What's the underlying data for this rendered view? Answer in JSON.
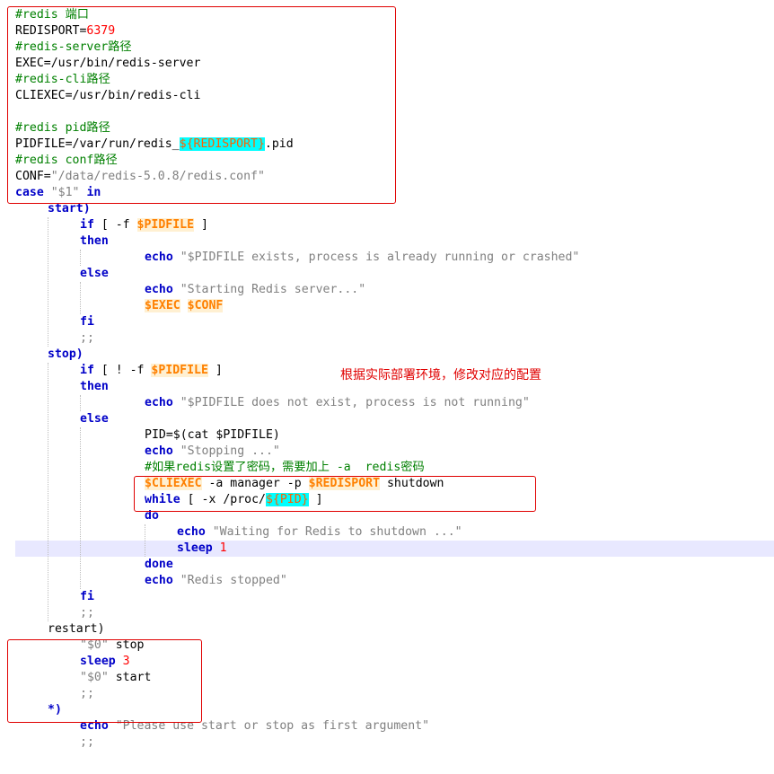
{
  "editor": {
    "annotation_note": "根据实际部署环境，修改对应的配置",
    "lines": [
      {
        "indent": 0,
        "tokens": [
          {
            "t": "#redis 端口",
            "c": "cm"
          }
        ]
      },
      {
        "indent": 0,
        "tokens": [
          {
            "t": "REDISPORT=",
            "c": "pl"
          },
          {
            "t": "6379",
            "c": "num"
          }
        ]
      },
      {
        "indent": 0,
        "tokens": [
          {
            "t": "#redis-server路径",
            "c": "cm"
          }
        ]
      },
      {
        "indent": 0,
        "tokens": [
          {
            "t": "EXEC=/usr/bin/redis-server",
            "c": "pl"
          }
        ]
      },
      {
        "indent": 0,
        "tokens": [
          {
            "t": "#redis-cli路径",
            "c": "cm"
          }
        ]
      },
      {
        "indent": 0,
        "tokens": [
          {
            "t": "CLIEXEC=/usr/bin/redis-cli",
            "c": "pl"
          }
        ]
      },
      {
        "indent": 0,
        "tokens": []
      },
      {
        "indent": 0,
        "tokens": [
          {
            "t": "#redis pid路径",
            "c": "cm"
          }
        ]
      },
      {
        "indent": 0,
        "tokens": [
          {
            "t": "PIDFILE=/var/run/redis_",
            "c": "pl"
          },
          {
            "t": "${REDISPORT}",
            "c": "cy"
          },
          {
            "t": ".pid",
            "c": "pl"
          }
        ]
      },
      {
        "indent": 0,
        "tokens": [
          {
            "t": "#redis conf路径",
            "c": "cm"
          }
        ]
      },
      {
        "indent": 0,
        "tokens": [
          {
            "t": "CONF=",
            "c": "pl"
          },
          {
            "t": "\"/data/redis-5.0.8/redis.conf\"",
            "c": "str"
          }
        ]
      },
      {
        "indent": 0,
        "tokens": [
          {
            "t": "case",
            "c": "kw"
          },
          {
            "t": " ",
            "c": "pl"
          },
          {
            "t": "\"$1\"",
            "c": "str"
          },
          {
            "t": " ",
            "c": "pl"
          },
          {
            "t": "in",
            "c": "kw"
          }
        ]
      },
      {
        "indent": 1,
        "tokens": [
          {
            "t": "start)",
            "c": "kw"
          }
        ]
      },
      {
        "indent": 2,
        "tokens": [
          {
            "t": "if",
            "c": "kw"
          },
          {
            "t": " [ -f ",
            "c": "pl"
          },
          {
            "t": "$PIDFILE",
            "c": "vr"
          },
          {
            "t": " ]",
            "c": "pl"
          }
        ]
      },
      {
        "indent": 2,
        "tokens": [
          {
            "t": "then",
            "c": "kw"
          }
        ]
      },
      {
        "indent": 4,
        "tokens": [
          {
            "t": "echo",
            "c": "kw"
          },
          {
            "t": " ",
            "c": "pl"
          },
          {
            "t": "\"$PIDFILE exists, process is already running or crashed\"",
            "c": "str"
          }
        ]
      },
      {
        "indent": 2,
        "tokens": [
          {
            "t": "else",
            "c": "kw"
          }
        ]
      },
      {
        "indent": 4,
        "tokens": [
          {
            "t": "echo",
            "c": "kw"
          },
          {
            "t": " ",
            "c": "pl"
          },
          {
            "t": "\"Starting Redis server...\"",
            "c": "str"
          }
        ]
      },
      {
        "indent": 4,
        "tokens": [
          {
            "t": "$EXEC",
            "c": "vr"
          },
          {
            "t": " ",
            "c": "pl"
          },
          {
            "t": "$CONF",
            "c": "vr"
          }
        ]
      },
      {
        "indent": 2,
        "tokens": [
          {
            "t": "fi",
            "c": "kw"
          }
        ]
      },
      {
        "indent": 2,
        "tokens": [
          {
            "t": ";;",
            "c": "str"
          }
        ]
      },
      {
        "indent": 1,
        "tokens": [
          {
            "t": "stop)",
            "c": "kw"
          }
        ]
      },
      {
        "indent": 2,
        "tokens": [
          {
            "t": "if",
            "c": "kw"
          },
          {
            "t": " [ ! -f ",
            "c": "pl"
          },
          {
            "t": "$PIDFILE",
            "c": "vr"
          },
          {
            "t": " ]",
            "c": "pl"
          }
        ]
      },
      {
        "indent": 2,
        "tokens": [
          {
            "t": "then",
            "c": "kw"
          }
        ]
      },
      {
        "indent": 4,
        "tokens": [
          {
            "t": "echo",
            "c": "kw"
          },
          {
            "t": " ",
            "c": "pl"
          },
          {
            "t": "\"$PIDFILE does not exist, process is not running\"",
            "c": "str"
          }
        ]
      },
      {
        "indent": 2,
        "tokens": [
          {
            "t": "else",
            "c": "kw"
          }
        ]
      },
      {
        "indent": 4,
        "tokens": [
          {
            "t": "PID=$(cat $PIDFILE)",
            "c": "pl"
          }
        ]
      },
      {
        "indent": 4,
        "tokens": [
          {
            "t": "echo",
            "c": "kw"
          },
          {
            "t": " ",
            "c": "pl"
          },
          {
            "t": "\"Stopping ...\"",
            "c": "str"
          }
        ]
      },
      {
        "indent": 4,
        "tokens": [
          {
            "t": "#如果redis设置了密码，需要加上 -a  redis密码",
            "c": "cm"
          }
        ]
      },
      {
        "indent": 4,
        "tokens": [
          {
            "t": "$CLIEXEC",
            "c": "vr"
          },
          {
            "t": " -a manager -p ",
            "c": "pl"
          },
          {
            "t": "$REDISPORT",
            "c": "vr"
          },
          {
            "t": " shutdown",
            "c": "pl"
          }
        ]
      },
      {
        "indent": 4,
        "tokens": [
          {
            "t": "while",
            "c": "kw"
          },
          {
            "t": " [ -x /proc/",
            "c": "pl"
          },
          {
            "t": "${PID}",
            "c": "cy"
          },
          {
            "t": " ]",
            "c": "pl"
          }
        ]
      },
      {
        "indent": 4,
        "tokens": [
          {
            "t": "do",
            "c": "kw"
          }
        ]
      },
      {
        "indent": 5,
        "tokens": [
          {
            "t": "echo",
            "c": "kw"
          },
          {
            "t": " ",
            "c": "pl"
          },
          {
            "t": "\"Waiting for Redis to shutdown ...\"",
            "c": "str"
          }
        ]
      },
      {
        "indent": 5,
        "tokens": [
          {
            "t": "sleep",
            "c": "kw"
          },
          {
            "t": " ",
            "c": "pl"
          },
          {
            "t": "1",
            "c": "num"
          }
        ]
      },
      {
        "indent": 4,
        "tokens": [
          {
            "t": "done",
            "c": "kw"
          }
        ]
      },
      {
        "indent": 4,
        "tokens": [
          {
            "t": "echo",
            "c": "kw"
          },
          {
            "t": " ",
            "c": "pl"
          },
          {
            "t": "\"Redis stopped\"",
            "c": "str"
          }
        ]
      },
      {
        "indent": 2,
        "tokens": [
          {
            "t": "fi",
            "c": "kw"
          }
        ]
      },
      {
        "indent": 2,
        "tokens": [
          {
            "t": ";;",
            "c": "str"
          }
        ]
      },
      {
        "indent": 1,
        "tokens": [
          {
            "t": "restart)",
            "c": "pl"
          }
        ]
      },
      {
        "indent": 2,
        "tokens": [
          {
            "t": "\"$0\"",
            "c": "str"
          },
          {
            "t": " stop",
            "c": "pl"
          }
        ]
      },
      {
        "indent": 2,
        "tokens": [
          {
            "t": "sleep",
            "c": "kw"
          },
          {
            "t": " ",
            "c": "pl"
          },
          {
            "t": "3",
            "c": "num"
          }
        ]
      },
      {
        "indent": 2,
        "tokens": [
          {
            "t": "\"$0\"",
            "c": "str"
          },
          {
            "t": " start",
            "c": "pl"
          }
        ]
      },
      {
        "indent": 2,
        "tokens": [
          {
            "t": ";;",
            "c": "str"
          }
        ]
      },
      {
        "indent": 1,
        "tokens": [
          {
            "t": "*)",
            "c": "kw"
          }
        ]
      },
      {
        "indent": 2,
        "tokens": [
          {
            "t": "echo",
            "c": "kw"
          },
          {
            "t": " ",
            "c": "pl"
          },
          {
            "t": "\"Please use start or stop as first argument\"",
            "c": "str"
          }
        ]
      },
      {
        "indent": 2,
        "tokens": [
          {
            "t": ";;",
            "c": "str"
          }
        ]
      }
    ]
  }
}
